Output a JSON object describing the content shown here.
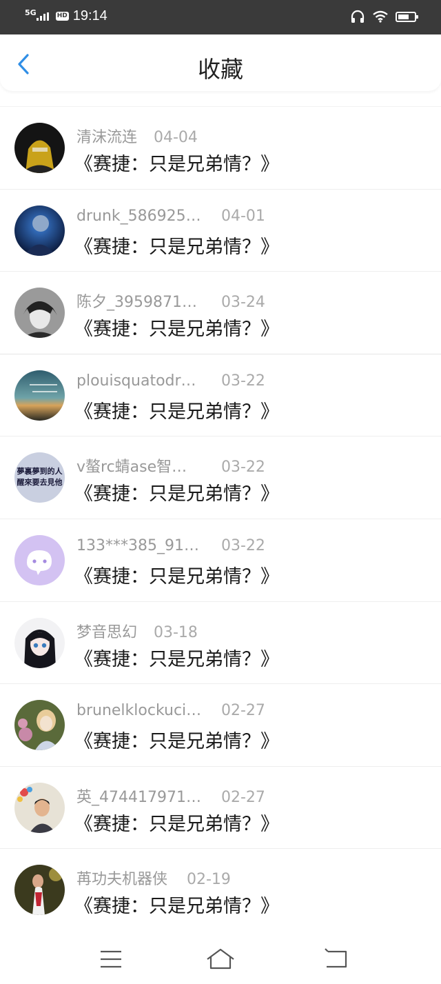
{
  "status_bar": {
    "network": "5G",
    "hd": "HD",
    "time": "19:14"
  },
  "header": {
    "title": "收藏",
    "back_icon": "chevron-left-icon"
  },
  "favorites": [
    {
      "user": "清沫流连",
      "date": "04-04",
      "title": "《赛捷：只是兄弟情？》"
    },
    {
      "user": "drunk_586925…",
      "date": "04-01",
      "title": "《赛捷：只是兄弟情？》"
    },
    {
      "user": "陈夕_3959871…",
      "date": "03-24",
      "title": "《赛捷：只是兄弟情？》"
    },
    {
      "user": "plouisquatodr…",
      "date": "03-22",
      "title": "《赛捷：只是兄弟情？》"
    },
    {
      "user": "v螯rc蜻ase智…",
      "date": "03-22",
      "title": "《赛捷：只是兄弟情？》",
      "avatar_text": "夢裏夢到的人\n醒來要去見他"
    },
    {
      "user": "133***385_91…",
      "date": "03-22",
      "title": "《赛捷：只是兄弟情？》"
    },
    {
      "user": "梦音思幻",
      "date": "03-18",
      "title": "《赛捷：只是兄弟情？》"
    },
    {
      "user": "brunelklockuci…",
      "date": "02-27",
      "title": "《赛捷：只是兄弟情？》"
    },
    {
      "user": "英_474417971…",
      "date": "02-27",
      "title": "《赛捷：只是兄弟情？》"
    },
    {
      "user": "苒功夫机器侠",
      "date": "02-19",
      "title": "《赛捷：只是兄弟情？》"
    }
  ],
  "colors": {
    "status_bar_bg": "#3a3a3a",
    "accent": "#2f8ee6",
    "username": "#999999",
    "title_text": "#1a1a1a"
  },
  "nav_bar": {
    "menu_icon": "menu-icon",
    "home_icon": "home-icon",
    "back_icon": "back-icon"
  }
}
